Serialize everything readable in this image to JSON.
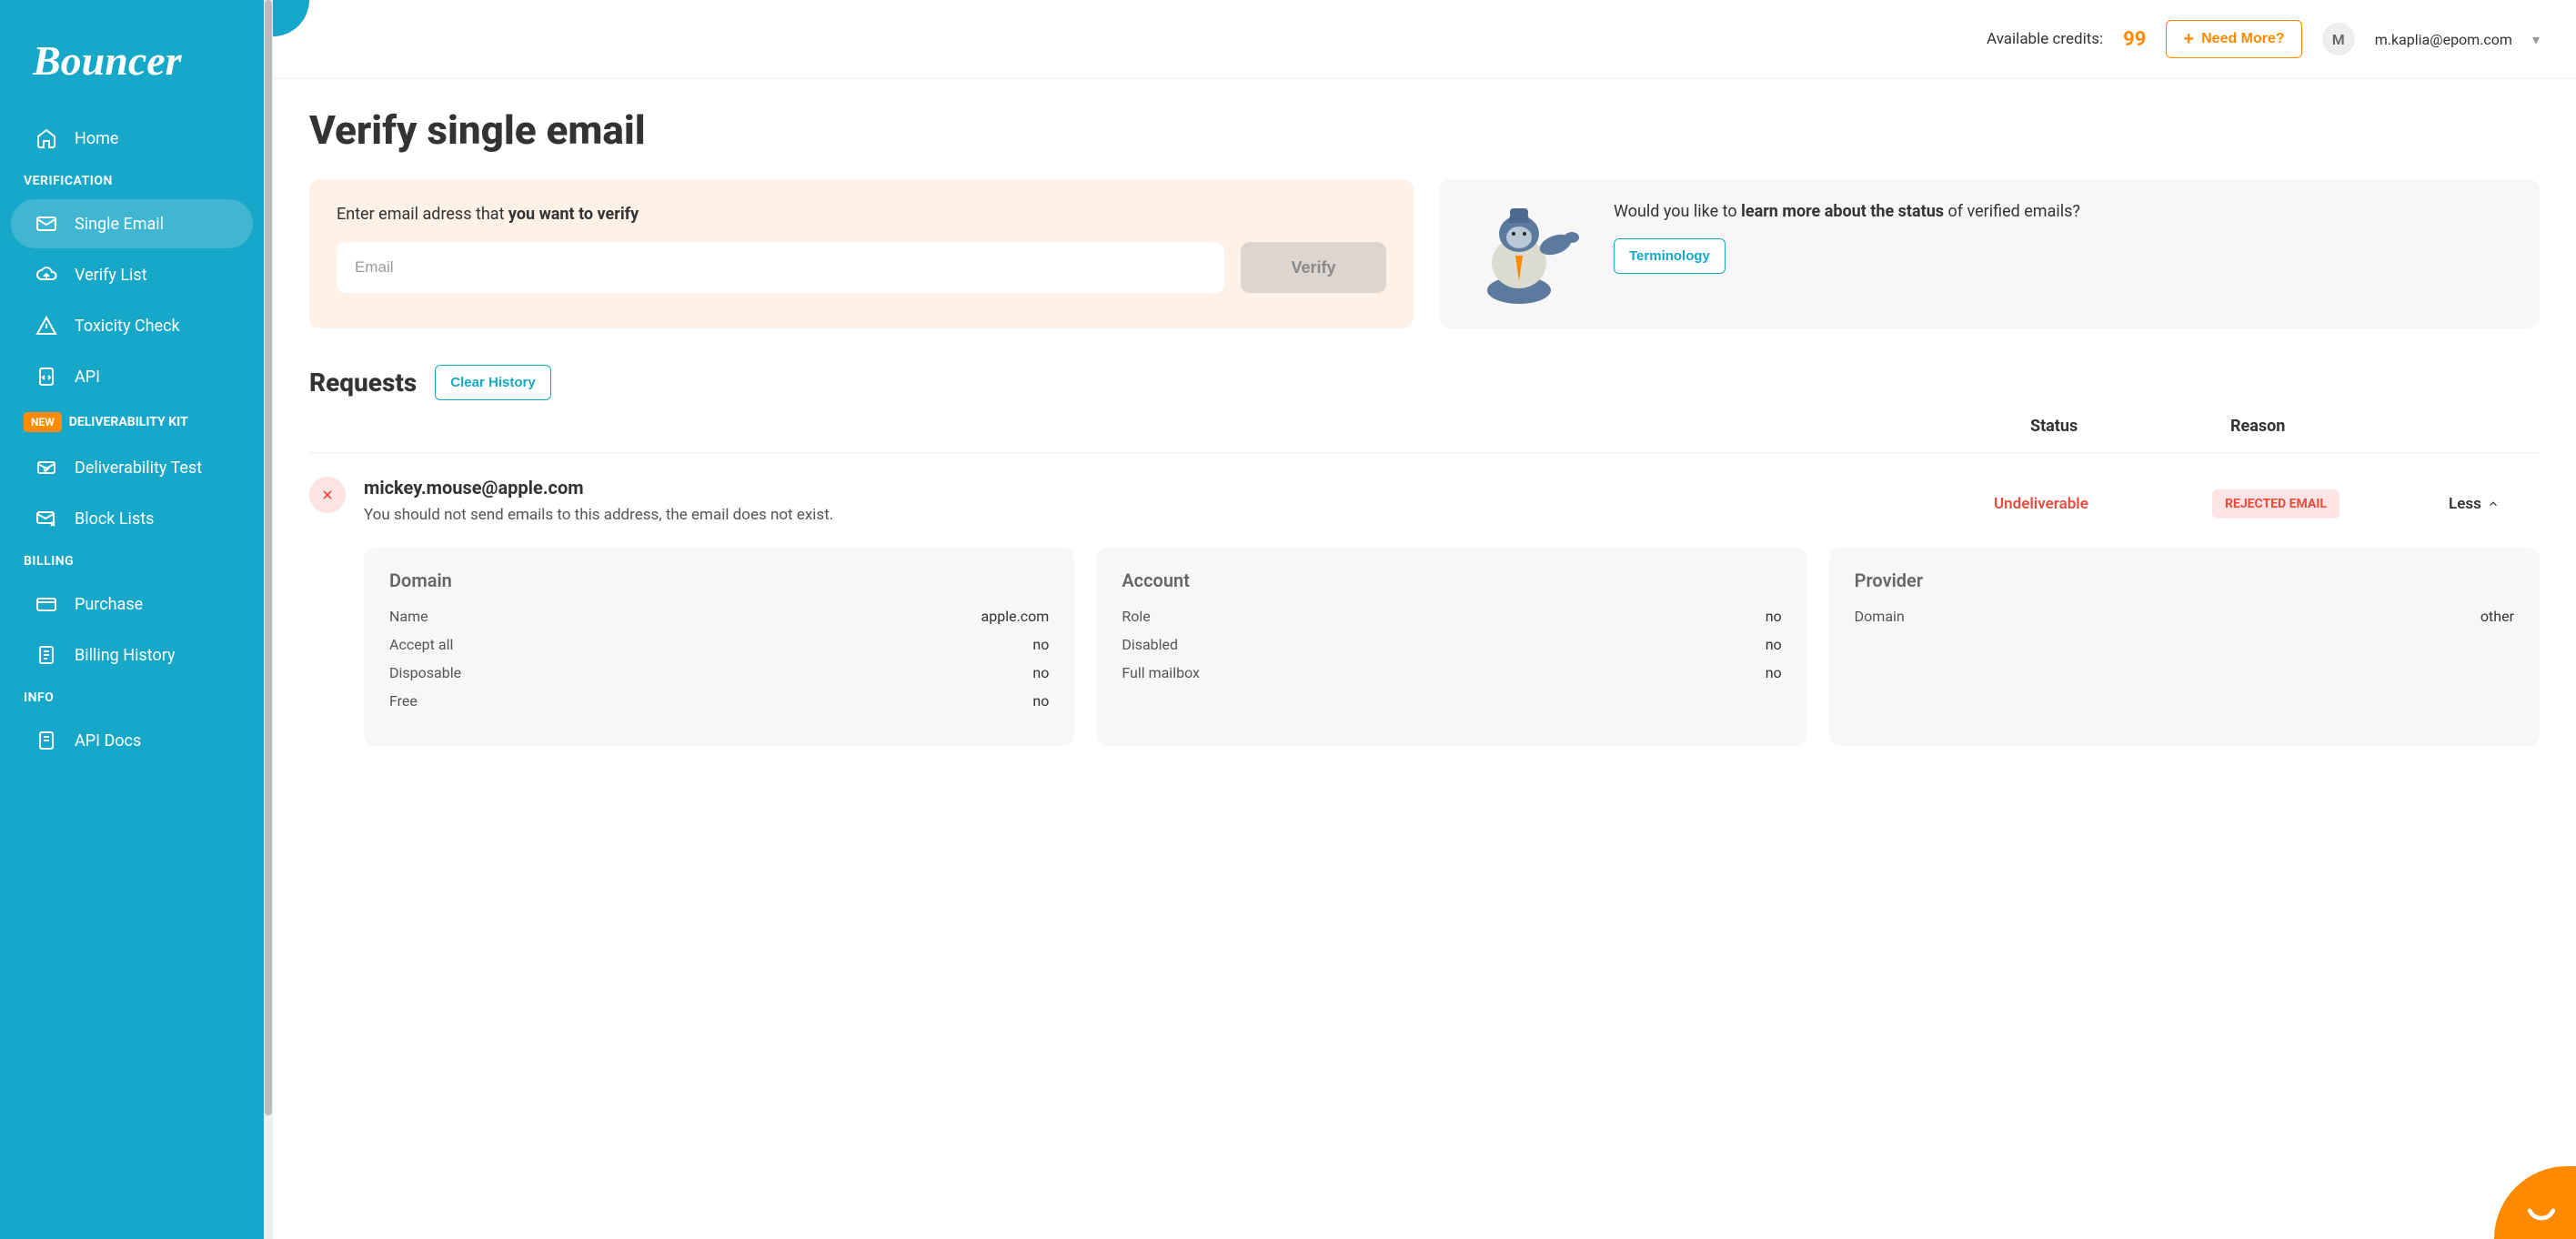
{
  "brand": "Bouncer",
  "sidebar": {
    "home": "Home",
    "sections": {
      "verification": "VERIFICATION",
      "deliverability_kit": "DELIVERABILITY KIT",
      "billing": "BILLING",
      "info": "INFO"
    },
    "new_badge": "NEW",
    "items": {
      "single_email": "Single Email",
      "verify_list": "Verify List",
      "toxicity_check": "Toxicity Check",
      "api": "API",
      "deliverability_test": "Deliverability Test",
      "block_lists": "Block Lists",
      "purchase": "Purchase",
      "billing_history": "Billing History",
      "api_docs": "API Docs"
    }
  },
  "topbar": {
    "credits_label": "Available credits:",
    "credits_value": "99",
    "need_more": "Need More?",
    "avatar_initial": "M",
    "user_email": "m.kaplia@epom.com"
  },
  "page": {
    "title": "Verify single email",
    "input_prompt_prefix": "Enter email adress that ",
    "input_prompt_bold": "you want to verify",
    "email_placeholder": "Email",
    "verify_button": "Verify",
    "info_prefix": "Would you like to ",
    "info_bold1": "learn more about the status",
    "info_suffix": " of verified emails?",
    "terminology_button": "Terminology"
  },
  "requests": {
    "title": "Requests",
    "clear_button": "Clear History",
    "col_status": "Status",
    "col_reason": "Reason",
    "rows": [
      {
        "email": "mickey.mouse@apple.com",
        "message": "You should not send emails to this address, the email does not exist.",
        "status": "Undeliverable",
        "reason": "REJECTED EMAIL",
        "toggle": "Less",
        "details": {
          "domain": {
            "title": "Domain",
            "name_label": "Name",
            "name_value": "apple.com",
            "accept_label": "Accept all",
            "accept_value": "no",
            "disposable_label": "Disposable",
            "disposable_value": "no",
            "free_label": "Free",
            "free_value": "no"
          },
          "account": {
            "title": "Account",
            "role_label": "Role",
            "role_value": "no",
            "disabled_label": "Disabled",
            "disabled_value": "no",
            "full_label": "Full mailbox",
            "full_value": "no"
          },
          "provider": {
            "title": "Provider",
            "domain_label": "Domain",
            "domain_value": "other"
          }
        }
      }
    ]
  }
}
